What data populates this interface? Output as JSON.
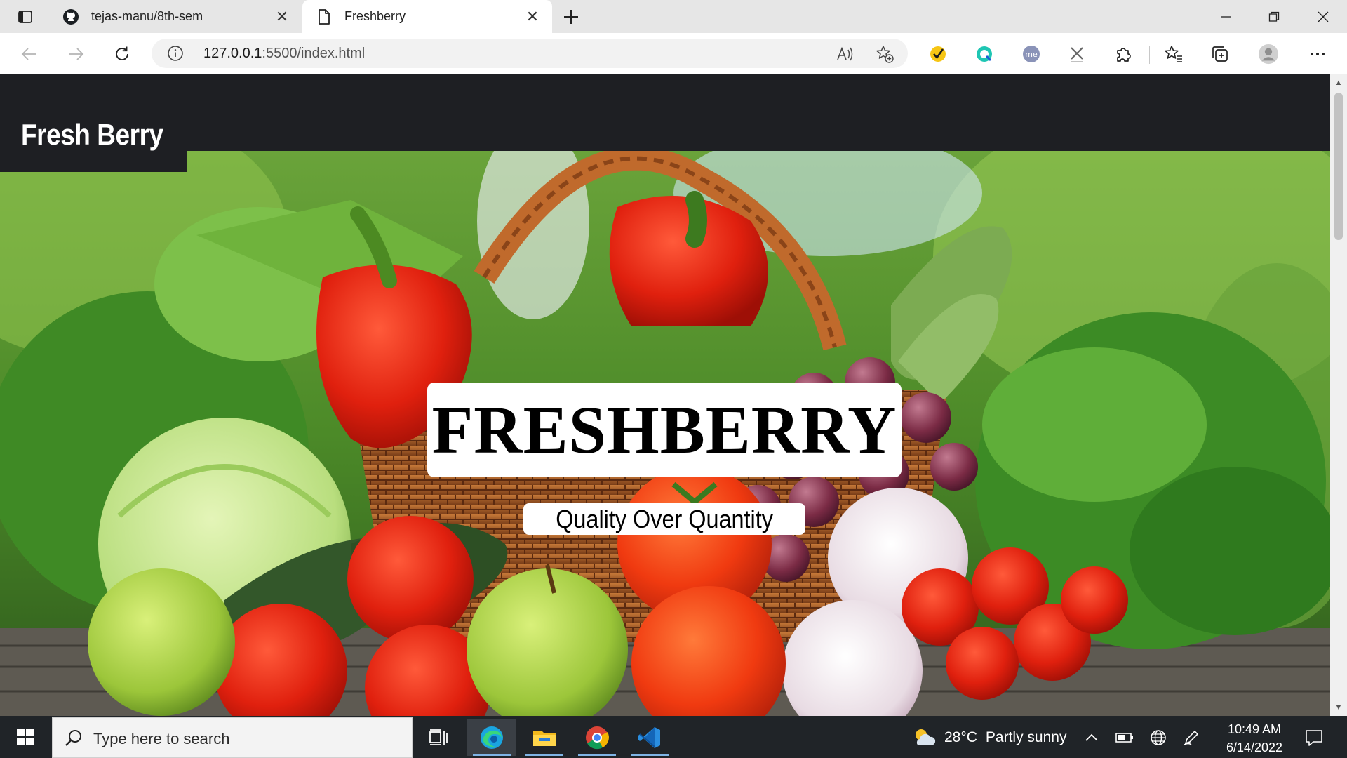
{
  "browser": {
    "tabs": [
      {
        "title": "tejas-manu/8th-sem",
        "favicon": "github-icon"
      },
      {
        "title": "Freshberry",
        "favicon": "page-icon",
        "active": true
      }
    ],
    "url_host": "127.0.0.1",
    "url_path": ":5500/index.html"
  },
  "page": {
    "brand": "Fresh Berry",
    "hero_title": "FRESHBERRY",
    "hero_subtitle": "Quality Over Quantity"
  },
  "taskbar": {
    "search_placeholder": "Type here to search",
    "weather_temp": "28°C",
    "weather_desc": "Partly sunny",
    "time": "10:49 AM",
    "date": "6/14/2022"
  }
}
